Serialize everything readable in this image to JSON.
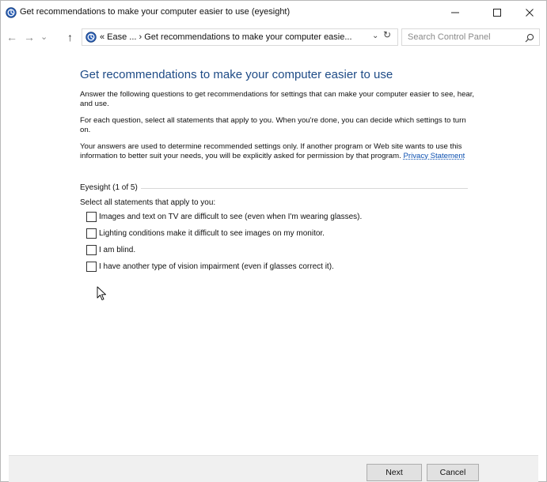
{
  "window": {
    "title": "Get recommendations to make your computer easier to use (eyesight)",
    "controls": {
      "minimize": "—",
      "maximize": "☐",
      "close": "✕"
    }
  },
  "navigation": {
    "back": "←",
    "forward": "→",
    "recent": "⌄",
    "up": "↑",
    "breadcrumb": "« Ease ...  ›  Get recommendations to make your computer easie...",
    "dropdown": "⌄",
    "refresh": "↻"
  },
  "search": {
    "placeholder": "Search Control Panel"
  },
  "main": {
    "heading": "Get recommendations to make your computer easier to use",
    "intro": "Answer the following questions to get recommendations for settings that can make your computer easier to see, hear, and use.",
    "instructions": "For each question, select all statements that apply to you.  When you're done, you can decide which settings to turn on.",
    "privacy_text": "Your answers are used to determine recommended settings only. If another program or Web site wants to use this information to better suit your needs, you will be explicitly asked for permission by that program. ",
    "privacy_link": "Privacy Statement",
    "group_label": "Eyesight (1 of 5)",
    "select_prompt": "Select all statements that apply to you:",
    "options": [
      {
        "label": "Images and text on TV are difficult to see (even when I'm wearing glasses).",
        "checked": false
      },
      {
        "label": "Lighting conditions make it difficult to see images on my monitor.",
        "checked": false
      },
      {
        "label": "I am blind.",
        "checked": false
      },
      {
        "label": "I have another type of vision impairment (even if glasses correct it).",
        "checked": false
      }
    ]
  },
  "footer": {
    "next": "Next",
    "cancel": "Cancel"
  },
  "colors": {
    "heading": "#1e4b86",
    "link": "#0b4fb0",
    "footer_bg": "#f0f0f0",
    "button_bg": "#e1e1e1"
  }
}
